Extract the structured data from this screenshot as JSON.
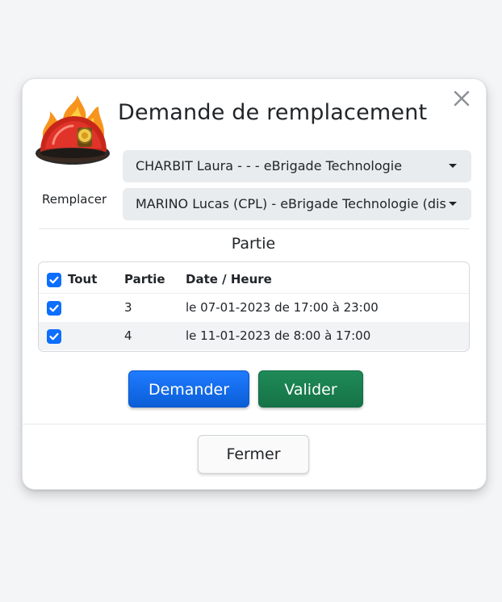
{
  "modal": {
    "title": "Demande de remplacement",
    "close_icon": "close-icon",
    "logo_icon": "firefighter-helmet-icon"
  },
  "form": {
    "select_1_value": "CHARBIT Laura - - - eBrigade Technologie",
    "remplacer_label": "Remplacer",
    "select_2_value": "MARINO Lucas (CPL) - eBrigade Technologie (dis (..."
  },
  "partie": {
    "section_title": "Partie",
    "headers": {
      "tout": "Tout",
      "partie": "Partie",
      "date_heure": "Date / Heure"
    },
    "rows": [
      {
        "checked": true,
        "partie": "3",
        "date_heure": "le 07-01-2023 de 17:00 à 23:00"
      },
      {
        "checked": true,
        "partie": "4",
        "date_heure": "le 11-01-2023 de 8:00 à 17:00"
      }
    ],
    "all_checked": true
  },
  "actions": {
    "demander_label": "Demander",
    "valider_label": "Valider",
    "fermer_label": "Fermer"
  },
  "colors": {
    "primary": "#0d6efd",
    "success": "#157347",
    "select_bg": "#e9ecef"
  }
}
